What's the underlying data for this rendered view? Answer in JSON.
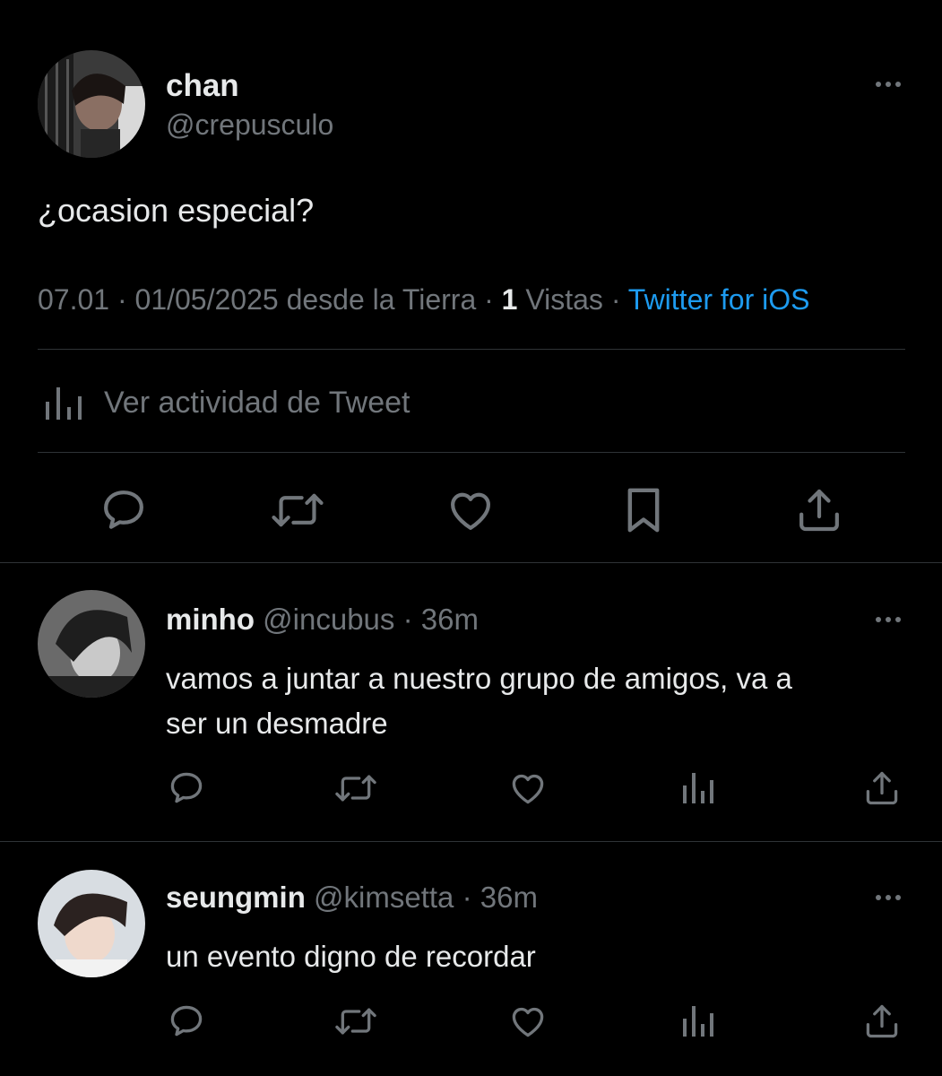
{
  "tweet": {
    "name": "chan",
    "handle": "@crepusculo",
    "text": "¿ocasion especial?",
    "time": "07.01 · 01/05/2025 desde la Tierra · ",
    "views_count": "1",
    "views_label": " Vistas · ",
    "source": "Twitter for iOS",
    "activity_label": "Ver actividad de Tweet"
  },
  "replies": [
    {
      "name": "minho",
      "handle": "@incubus",
      "time": "· 36m",
      "text_line1": "vamos a juntar a nuestro grupo de amigos, va a",
      "text_line2": "ser un desmadre"
    },
    {
      "name": "seungmin",
      "handle": "@kimsetta",
      "time": "· 36m",
      "text_line1": "un evento digno de recordar"
    }
  ],
  "icons": {
    "reply": "reply-icon",
    "retweet": "retweet-icon",
    "like": "heart-icon",
    "bookmark": "bookmark-icon",
    "share": "share-icon",
    "views": "views-icon",
    "more": "more-icon"
  },
  "colors": {
    "background": "#000000",
    "text": "#e7e9ea",
    "muted": "#71767b",
    "accent": "#1d9bf0",
    "divider": "#2f3336"
  }
}
